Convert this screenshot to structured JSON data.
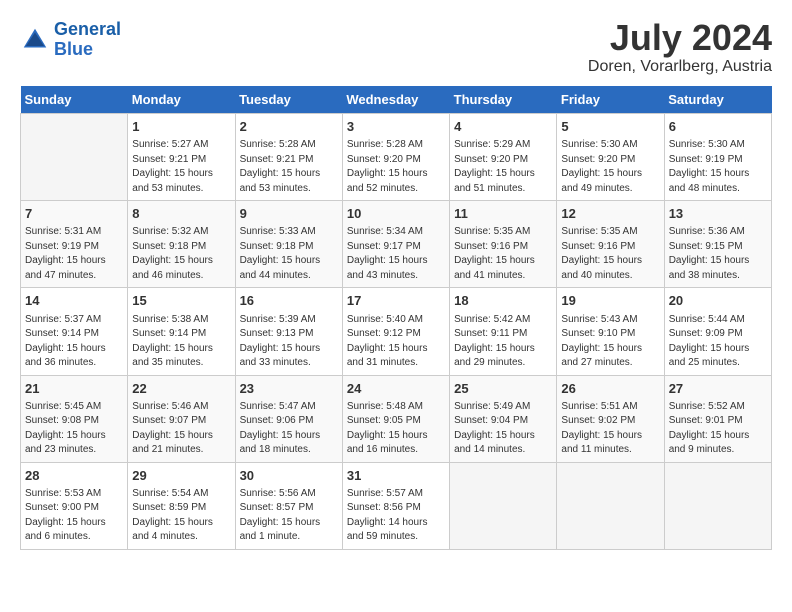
{
  "header": {
    "logo_line1": "General",
    "logo_line2": "Blue",
    "month_year": "July 2024",
    "location": "Doren, Vorarlberg, Austria"
  },
  "weekdays": [
    "Sunday",
    "Monday",
    "Tuesday",
    "Wednesday",
    "Thursday",
    "Friday",
    "Saturday"
  ],
  "weeks": [
    [
      {
        "day": "",
        "info": ""
      },
      {
        "day": "1",
        "info": "Sunrise: 5:27 AM\nSunset: 9:21 PM\nDaylight: 15 hours\nand 53 minutes."
      },
      {
        "day": "2",
        "info": "Sunrise: 5:28 AM\nSunset: 9:21 PM\nDaylight: 15 hours\nand 53 minutes."
      },
      {
        "day": "3",
        "info": "Sunrise: 5:28 AM\nSunset: 9:20 PM\nDaylight: 15 hours\nand 52 minutes."
      },
      {
        "day": "4",
        "info": "Sunrise: 5:29 AM\nSunset: 9:20 PM\nDaylight: 15 hours\nand 51 minutes."
      },
      {
        "day": "5",
        "info": "Sunrise: 5:30 AM\nSunset: 9:20 PM\nDaylight: 15 hours\nand 49 minutes."
      },
      {
        "day": "6",
        "info": "Sunrise: 5:30 AM\nSunset: 9:19 PM\nDaylight: 15 hours\nand 48 minutes."
      }
    ],
    [
      {
        "day": "7",
        "info": "Sunrise: 5:31 AM\nSunset: 9:19 PM\nDaylight: 15 hours\nand 47 minutes."
      },
      {
        "day": "8",
        "info": "Sunrise: 5:32 AM\nSunset: 9:18 PM\nDaylight: 15 hours\nand 46 minutes."
      },
      {
        "day": "9",
        "info": "Sunrise: 5:33 AM\nSunset: 9:18 PM\nDaylight: 15 hours\nand 44 minutes."
      },
      {
        "day": "10",
        "info": "Sunrise: 5:34 AM\nSunset: 9:17 PM\nDaylight: 15 hours\nand 43 minutes."
      },
      {
        "day": "11",
        "info": "Sunrise: 5:35 AM\nSunset: 9:16 PM\nDaylight: 15 hours\nand 41 minutes."
      },
      {
        "day": "12",
        "info": "Sunrise: 5:35 AM\nSunset: 9:16 PM\nDaylight: 15 hours\nand 40 minutes."
      },
      {
        "day": "13",
        "info": "Sunrise: 5:36 AM\nSunset: 9:15 PM\nDaylight: 15 hours\nand 38 minutes."
      }
    ],
    [
      {
        "day": "14",
        "info": "Sunrise: 5:37 AM\nSunset: 9:14 PM\nDaylight: 15 hours\nand 36 minutes."
      },
      {
        "day": "15",
        "info": "Sunrise: 5:38 AM\nSunset: 9:14 PM\nDaylight: 15 hours\nand 35 minutes."
      },
      {
        "day": "16",
        "info": "Sunrise: 5:39 AM\nSunset: 9:13 PM\nDaylight: 15 hours\nand 33 minutes."
      },
      {
        "day": "17",
        "info": "Sunrise: 5:40 AM\nSunset: 9:12 PM\nDaylight: 15 hours\nand 31 minutes."
      },
      {
        "day": "18",
        "info": "Sunrise: 5:42 AM\nSunset: 9:11 PM\nDaylight: 15 hours\nand 29 minutes."
      },
      {
        "day": "19",
        "info": "Sunrise: 5:43 AM\nSunset: 9:10 PM\nDaylight: 15 hours\nand 27 minutes."
      },
      {
        "day": "20",
        "info": "Sunrise: 5:44 AM\nSunset: 9:09 PM\nDaylight: 15 hours\nand 25 minutes."
      }
    ],
    [
      {
        "day": "21",
        "info": "Sunrise: 5:45 AM\nSunset: 9:08 PM\nDaylight: 15 hours\nand 23 minutes."
      },
      {
        "day": "22",
        "info": "Sunrise: 5:46 AM\nSunset: 9:07 PM\nDaylight: 15 hours\nand 21 minutes."
      },
      {
        "day": "23",
        "info": "Sunrise: 5:47 AM\nSunset: 9:06 PM\nDaylight: 15 hours\nand 18 minutes."
      },
      {
        "day": "24",
        "info": "Sunrise: 5:48 AM\nSunset: 9:05 PM\nDaylight: 15 hours\nand 16 minutes."
      },
      {
        "day": "25",
        "info": "Sunrise: 5:49 AM\nSunset: 9:04 PM\nDaylight: 15 hours\nand 14 minutes."
      },
      {
        "day": "26",
        "info": "Sunrise: 5:51 AM\nSunset: 9:02 PM\nDaylight: 15 hours\nand 11 minutes."
      },
      {
        "day": "27",
        "info": "Sunrise: 5:52 AM\nSunset: 9:01 PM\nDaylight: 15 hours\nand 9 minutes."
      }
    ],
    [
      {
        "day": "28",
        "info": "Sunrise: 5:53 AM\nSunset: 9:00 PM\nDaylight: 15 hours\nand 6 minutes."
      },
      {
        "day": "29",
        "info": "Sunrise: 5:54 AM\nSunset: 8:59 PM\nDaylight: 15 hours\nand 4 minutes."
      },
      {
        "day": "30",
        "info": "Sunrise: 5:56 AM\nSunset: 8:57 PM\nDaylight: 15 hours\nand 1 minute."
      },
      {
        "day": "31",
        "info": "Sunrise: 5:57 AM\nSunset: 8:56 PM\nDaylight: 14 hours\nand 59 minutes."
      },
      {
        "day": "",
        "info": ""
      },
      {
        "day": "",
        "info": ""
      },
      {
        "day": "",
        "info": ""
      }
    ]
  ]
}
